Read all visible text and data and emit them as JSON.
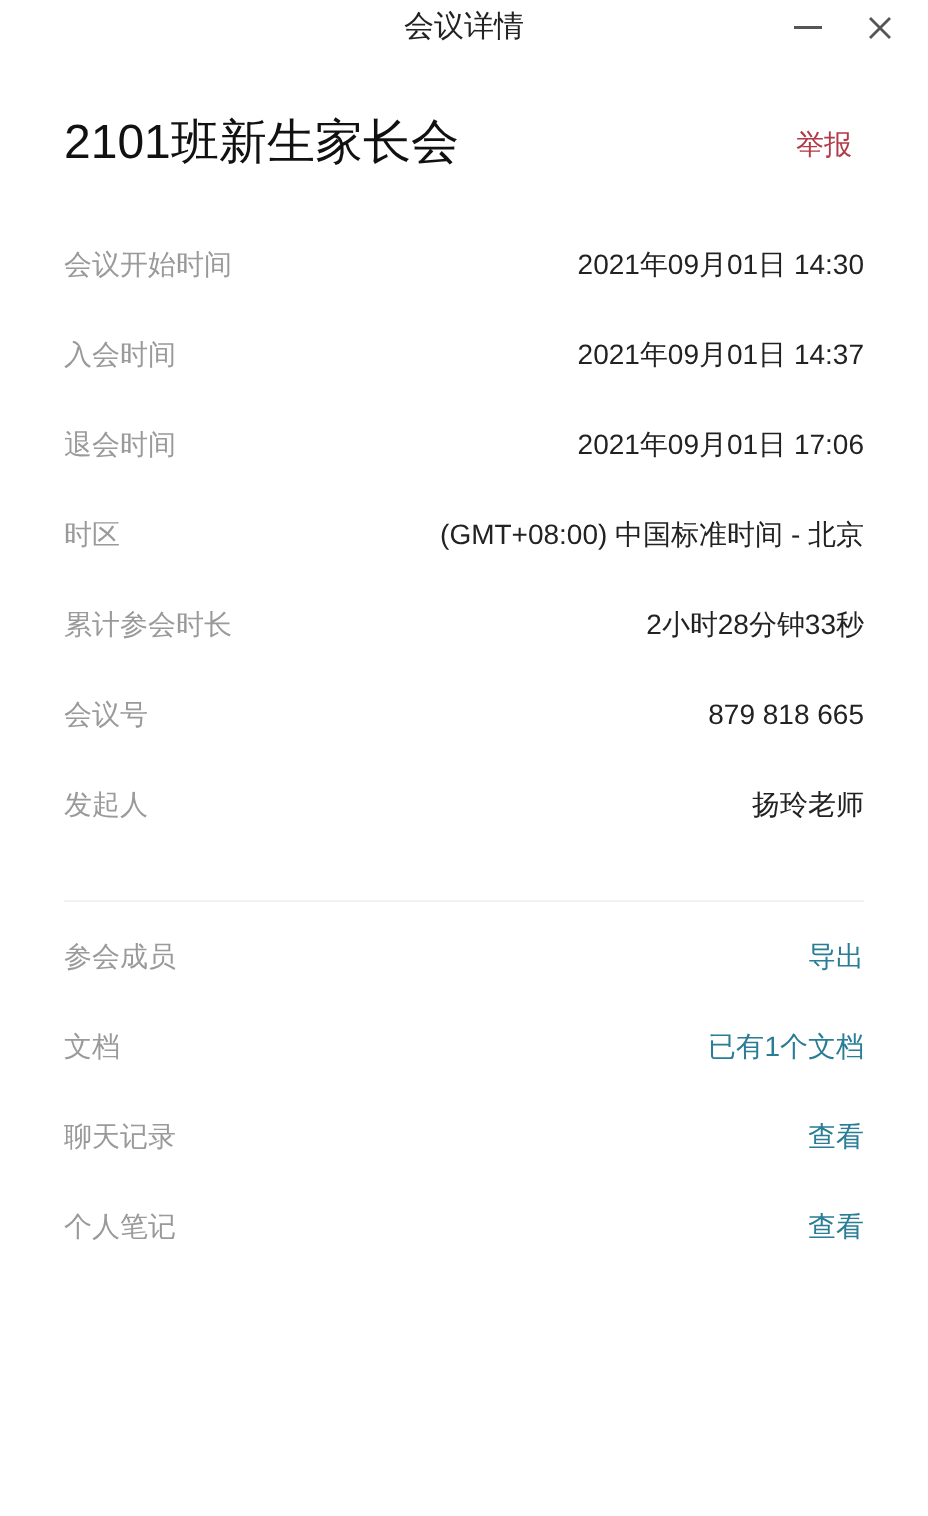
{
  "window": {
    "title": "会议详情",
    "controls": [
      {
        "kind": "minimize"
      },
      {
        "kind": "close"
      }
    ]
  },
  "meeting": {
    "name": "2101班新生家长会",
    "report": "举报"
  },
  "details": [
    {
      "label": "会议开始时间",
      "value": "2021年09月01日 14:30"
    },
    {
      "label": "入会时间",
      "value": "2021年09月01日 14:37"
    },
    {
      "label": "退会时间",
      "value": "2021年09月01日 17:06"
    },
    {
      "label": "时区",
      "value": "(GMT+08:00) 中国标准时间 - 北京"
    },
    {
      "label": "累计参会时长",
      "value": "2小时28分钟33秒"
    },
    {
      "label": "会议号",
      "value": "879 818 665"
    },
    {
      "label": "发起人",
      "value": "扬玲老师"
    }
  ],
  "links": [
    {
      "label": "参会成员",
      "action": "导出"
    },
    {
      "label": "文档",
      "action": "已有1个文档"
    },
    {
      "label": "聊天记录",
      "action": "查看"
    },
    {
      "label": "个人笔记",
      "action": "查看"
    }
  ]
}
